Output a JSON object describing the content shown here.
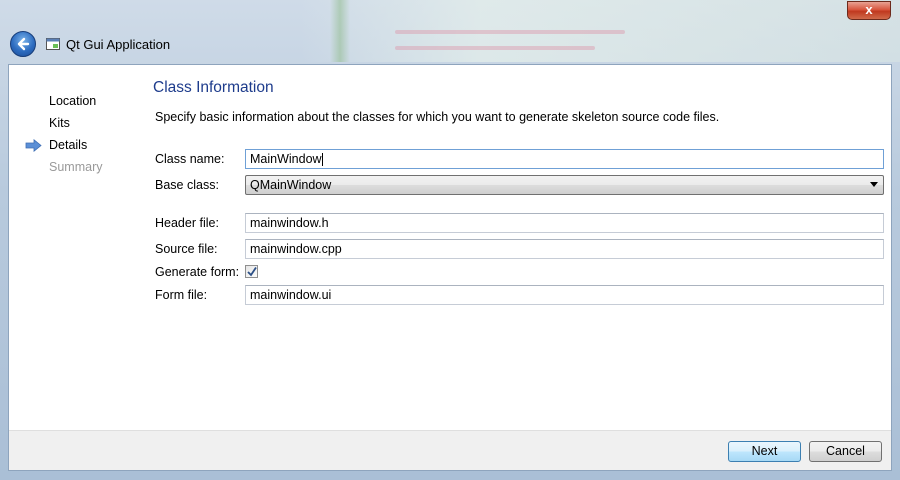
{
  "window": {
    "title": "Qt Gui Application",
    "close_label": "x"
  },
  "wizard": {
    "steps": [
      {
        "label": "Location",
        "state": "done"
      },
      {
        "label": "Kits",
        "state": "done"
      },
      {
        "label": "Details",
        "state": "current"
      },
      {
        "label": "Summary",
        "state": "pending"
      }
    ],
    "page_title": "Class Information",
    "description": "Specify basic information about the classes for which you want to generate skeleton source code files."
  },
  "form": {
    "class_name_label": "Class name:",
    "class_name_value": "MainWindow",
    "base_class_label": "Base class:",
    "base_class_value": "QMainWindow",
    "header_file_label": "Header file:",
    "header_file_value": "mainwindow.h",
    "source_file_label": "Source file:",
    "source_file_value": "mainwindow.cpp",
    "generate_form_label": "Generate form:",
    "generate_form_checked": true,
    "form_file_label": "Form file:",
    "form_file_value": "mainwindow.ui"
  },
  "footer": {
    "next_label": "Next",
    "cancel_label": "Cancel"
  },
  "colors": {
    "heading": "#1e3c8c",
    "current_step_arrow": "#5b8fd6",
    "inactive_step": "#9a9a9a"
  }
}
